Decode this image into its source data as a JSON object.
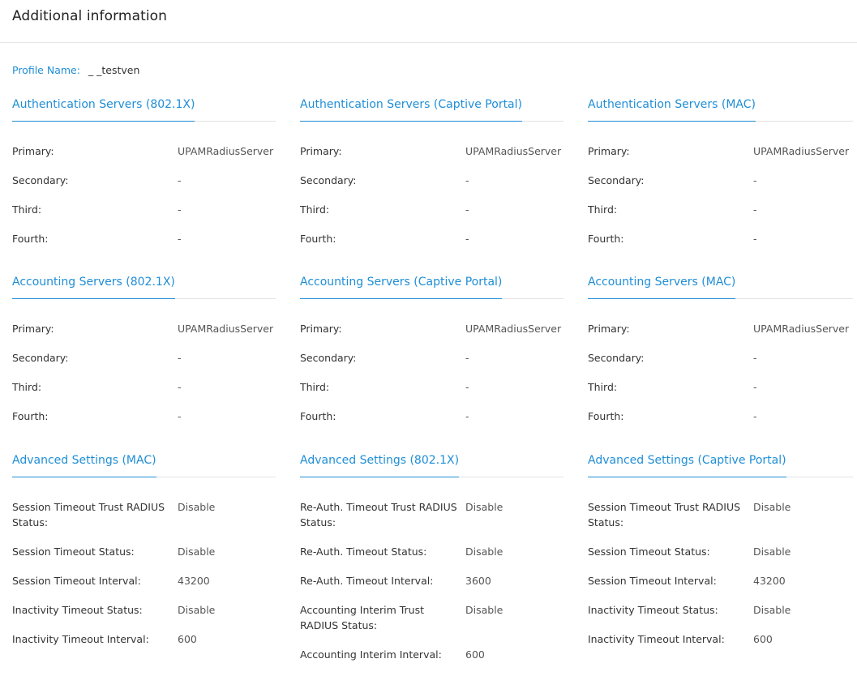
{
  "header": {
    "title": "Additional information"
  },
  "profile": {
    "label": "Profile Name:",
    "value": "_ _testven"
  },
  "columns": [
    {
      "sections": [
        {
          "title": "Authentication Servers (802.1X)",
          "rows": [
            {
              "label": "Primary:",
              "value": "UPAMRadiusServer"
            },
            {
              "label": "Secondary:",
              "value": "-"
            },
            {
              "label": "Third:",
              "value": "-"
            },
            {
              "label": "Fourth:",
              "value": "-"
            }
          ]
        },
        {
          "title": "Accounting Servers (802.1X)",
          "rows": [
            {
              "label": "Primary:",
              "value": "UPAMRadiusServer"
            },
            {
              "label": "Secondary:",
              "value": "-"
            },
            {
              "label": "Third:",
              "value": "-"
            },
            {
              "label": "Fourth:",
              "value": "-"
            }
          ]
        },
        {
          "title": "Advanced Settings (MAC)",
          "rows": [
            {
              "label": "Session Timeout Trust RADIUS Status:",
              "value": "Disable"
            },
            {
              "label": "Session Timeout Status:",
              "value": "Disable"
            },
            {
              "label": "Session Timeout Interval:",
              "value": "43200"
            },
            {
              "label": "Inactivity Timeout Status:",
              "value": "Disable"
            },
            {
              "label": "Inactivity Timeout Interval:",
              "value": "600"
            }
          ]
        }
      ]
    },
    {
      "sections": [
        {
          "title": "Authentication Servers (Captive Portal)",
          "rows": [
            {
              "label": "Primary:",
              "value": "UPAMRadiusServer"
            },
            {
              "label": "Secondary:",
              "value": "-"
            },
            {
              "label": "Third:",
              "value": "-"
            },
            {
              "label": "Fourth:",
              "value": "-"
            }
          ]
        },
        {
          "title": "Accounting Servers (Captive Portal)",
          "rows": [
            {
              "label": "Primary:",
              "value": "UPAMRadiusServer"
            },
            {
              "label": "Secondary:",
              "value": "-"
            },
            {
              "label": "Third:",
              "value": "-"
            },
            {
              "label": "Fourth:",
              "value": "-"
            }
          ]
        },
        {
          "title": "Advanced Settings (802.1X)",
          "rows": [
            {
              "label": "Re-Auth. Timeout Trust RADIUS Status:",
              "value": "Disable"
            },
            {
              "label": "Re-Auth. Timeout Status:",
              "value": "Disable"
            },
            {
              "label": "Re-Auth. Timeout Interval:",
              "value": "3600"
            },
            {
              "label": "Accounting Interim Trust RADIUS Status:",
              "value": "Disable"
            },
            {
              "label": "Accounting Interim Interval:",
              "value": "600"
            }
          ]
        }
      ]
    },
    {
      "sections": [
        {
          "title": "Authentication Servers (MAC)",
          "rows": [
            {
              "label": "Primary:",
              "value": "UPAMRadiusServer"
            },
            {
              "label": "Secondary:",
              "value": "-"
            },
            {
              "label": "Third:",
              "value": "-"
            },
            {
              "label": "Fourth:",
              "value": "-"
            }
          ]
        },
        {
          "title": "Accounting Servers (MAC)",
          "rows": [
            {
              "label": "Primary:",
              "value": "UPAMRadiusServer"
            },
            {
              "label": "Secondary:",
              "value": "-"
            },
            {
              "label": "Third:",
              "value": "-"
            },
            {
              "label": "Fourth:",
              "value": "-"
            }
          ]
        },
        {
          "title": "Advanced Settings (Captive Portal)",
          "rows": [
            {
              "label": "Session Timeout Trust RADIUS Status:",
              "value": "Disable"
            },
            {
              "label": "Session Timeout Status:",
              "value": "Disable"
            },
            {
              "label": "Session Timeout Interval:",
              "value": "43200"
            },
            {
              "label": "Inactivity Timeout Status:",
              "value": "Disable"
            },
            {
              "label": "Inactivity Timeout Interval:",
              "value": "600"
            }
          ]
        }
      ]
    }
  ],
  "colors": {
    "accent": "#1f8ed6",
    "divider": "#e2e2e2",
    "text": "#333333"
  }
}
